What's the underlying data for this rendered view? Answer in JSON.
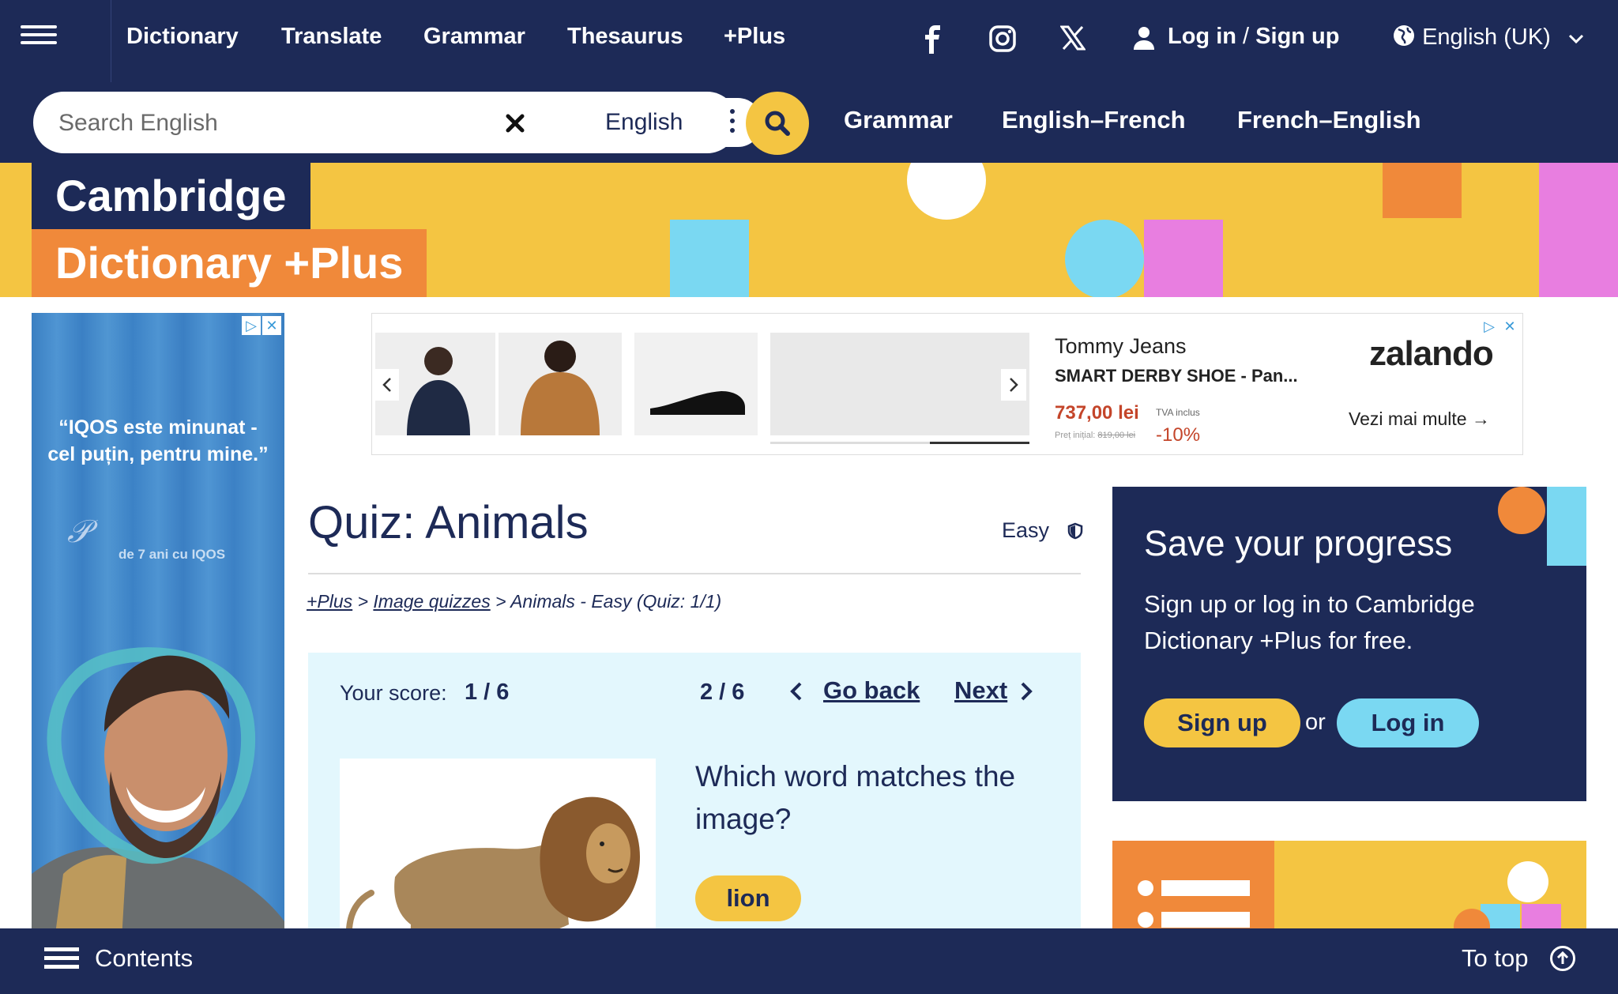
{
  "topnav": {
    "links": [
      "Dictionary",
      "Translate",
      "Grammar",
      "Thesaurus",
      "+Plus"
    ],
    "login": "Log in",
    "separator": "/",
    "signup": "Sign up",
    "language": "English (UK)"
  },
  "search": {
    "placeholder": "Search English",
    "dictionary": "English",
    "quicklinks": [
      "Grammar",
      "English–French",
      "French–English"
    ]
  },
  "brand": {
    "line1": "Cambridge",
    "line2": "Dictionary +Plus"
  },
  "left_ad": {
    "quote": "“IQOS este minunat - cel puțin, pentru mine.”",
    "tagline": "de 7 ani cu IQOS"
  },
  "top_ad": {
    "brand": "Tommy Jeans",
    "product": "SMART DERBY SHOE - Pan...",
    "price": "737,00 lei",
    "vat": "TVA inclus",
    "initial_price_label": "Preț inițial:",
    "initial_price": "819,00 lei",
    "discount": "-10%",
    "logo": "zalando",
    "more": "Vezi mai multe"
  },
  "quiz": {
    "title": "Quiz: Animals",
    "difficulty": "Easy",
    "breadcrumb": {
      "plus": "+Plus",
      "sep": ">",
      "image_quizzes": "Image quizzes",
      "rest": "> Animals - Easy (Quiz: 1/1)"
    },
    "score_label": "Your score:",
    "score": "1 / 6",
    "progress": "2 / 6",
    "go_back": "Go back",
    "next": "Next",
    "question": "Which word matches the image?",
    "answer": "lion"
  },
  "save_panel": {
    "title": "Save your progress",
    "text": "Sign up or log in to Cambridge Dictionary +Plus for free.",
    "signup": "Sign up",
    "or": "or",
    "login": "Log in"
  },
  "bottombar": {
    "contents": "Contents",
    "to_top": "To top"
  },
  "colors": {
    "navy": "#1d2a57",
    "yellow": "#f4c542",
    "orange": "#f0893a",
    "cyan": "#7ad8f2",
    "pink": "#e87ee0",
    "quiz_panel": "#e3f7fd"
  }
}
